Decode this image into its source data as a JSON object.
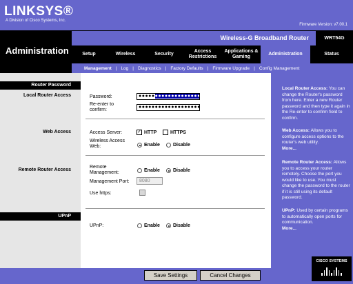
{
  "header": {
    "brand": "LINKSYS®",
    "tagline": "A Division of Cisco Systems, Inc.",
    "firmware": "Firmware Version: v7.00.1",
    "product_name": "Wireless-G Broadband Router",
    "product_model": "WRT54G",
    "section": "Administration"
  },
  "tabs": [
    {
      "label": "Setup"
    },
    {
      "label": "Wireless"
    },
    {
      "label": "Security"
    },
    {
      "label": "Access Restrictions"
    },
    {
      "label": "Applications & Gaming"
    },
    {
      "label": "Administration"
    },
    {
      "label": "Status"
    }
  ],
  "subtabs": [
    "Management",
    "Log",
    "Diagnostics",
    "Factory Defaults",
    "Firmware Upgrade",
    "Config Management"
  ],
  "sections": {
    "router_password": "Router Password",
    "local_router_access": "Local Router Access",
    "web_access": "Web Access",
    "remote_router_access": "Remote Router Access",
    "upnp": "UPnP"
  },
  "fields": {
    "password_label": "Password:",
    "password_dots": "●●●●●",
    "password_selected": "●●●●●●●●●●●●●●",
    "reenter_label": "Re-enter to confirm:",
    "reenter_dots": "●●●●●●●●●●●●●●●●●●●",
    "access_server_label": "Access Server:",
    "http_label": "HTTP",
    "https_label": "HTTPS",
    "wireless_web_label": "Wireless Access Web:",
    "enable": "Enable",
    "disable": "Disable",
    "remote_mgmt_label": "Remote Management:",
    "mgmt_port_label": "Management Port:",
    "mgmt_port_value": "8080",
    "use_https_label": "Use https:",
    "upnp_label": "UPnP:",
    "check": "✓"
  },
  "help": {
    "local_title": "Local Router Access:",
    "local_text": "You can change the Router's password from here. Enter a new Router password and then type it again in the Re-enter to confirm field to confirm.",
    "web_title": "Web Access:",
    "web_text": "Allows you to configure access options to the router's web utility.",
    "web_more": "More...",
    "remote_title": "Remote Router Access:",
    "remote_text": "Allows you to access your router remotely. Choose the port you would like to use. You must change the password to the router if it is still using its default password.",
    "upnp_title": "UPnP:",
    "upnp_text": "Used by certain programs to automatically open ports for communication.",
    "upnp_more": "More..."
  },
  "buttons": {
    "save": "Save Settings",
    "cancel": "Cancel Changes"
  },
  "cisco": "CISCO SYSTEMS",
  "colors": {
    "accent": "#6666cc",
    "black": "#000000",
    "left_gray": "#e6e6e6"
  }
}
